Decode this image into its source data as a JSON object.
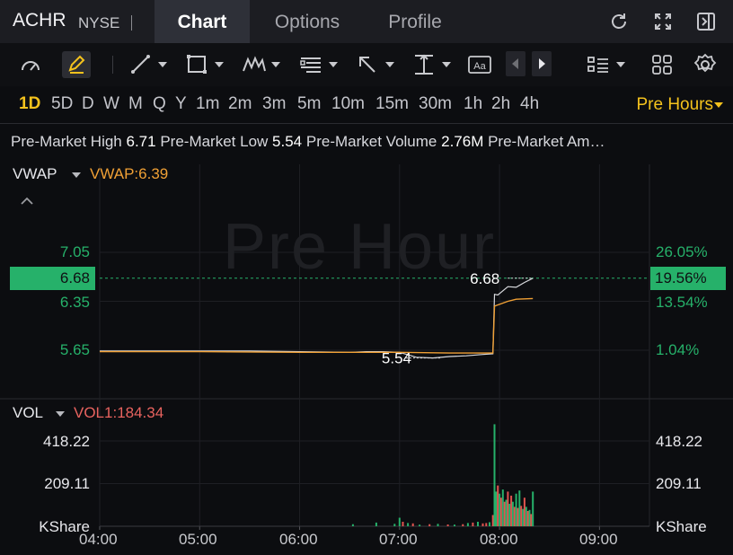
{
  "header": {
    "ticker": "ACHR",
    "exchange": "NYSE",
    "tabs": [
      {
        "label": "Chart",
        "active": true
      },
      {
        "label": "Options",
        "active": false
      },
      {
        "label": "Profile",
        "active": false
      }
    ],
    "icons": [
      "refresh-icon",
      "expand-icon",
      "collapse-panel-icon"
    ]
  },
  "toolbar": {
    "icons": [
      "gauge-icon",
      "pencil-icon",
      "line-tool-icon",
      "rectangle-tool-icon",
      "pattern-tool-icon",
      "fibonacci-tool-icon",
      "arrow-tool-icon",
      "measure-tool-icon",
      "text-tool-icon",
      "prev-icon",
      "next-icon",
      "layout-icon",
      "grid-icon",
      "settings-icon"
    ],
    "text_tool_label": "Aa"
  },
  "timeframes": [
    "1D",
    "5D",
    "D",
    "W",
    "M",
    "Q",
    "Y",
    "1m",
    "2m",
    "3m",
    "5m",
    "10m",
    "15m",
    "30m",
    "1h",
    "2h",
    "4h"
  ],
  "active_timeframe": "1D",
  "session": {
    "label": "Pre Hours"
  },
  "stats": {
    "high_label": "Pre-Market High",
    "high_value": "6.71",
    "low_label": "Pre-Market Low",
    "low_value": "5.54",
    "volume_label": "Pre-Market Volume",
    "volume_value": "2.76M",
    "amount_label": "Pre-Market Am…"
  },
  "price_panel": {
    "indicator": "VWAP",
    "indicator_value": "VWAP:6.39",
    "watermark": "Pre Hour",
    "left_ticks": [
      "7.05",
      "6.35",
      "5.65"
    ],
    "right_ticks": [
      "26.05%",
      "13.54%",
      "1.04%"
    ],
    "current_price": "6.68",
    "current_pct": "19.56%",
    "high_marker": "6.68",
    "low_marker": "5.54"
  },
  "volume_panel": {
    "indicator": "VOL",
    "indicator_value": "VOL1:184.34",
    "left_ticks": [
      "418.22",
      "209.11",
      "KShare"
    ],
    "right_ticks": [
      "418.22",
      "209.11",
      "KShare"
    ]
  },
  "time_axis": [
    "04:00",
    "05:00",
    "06:00",
    "07:00",
    "08:00",
    "09:00"
  ],
  "colors": {
    "up": "#26b16a",
    "down": "#e0534f",
    "vwap": "#f0a035",
    "price_line": "#d9dade",
    "accent": "#f4c21d",
    "volume_label": "#e8635f"
  },
  "chart_data": [
    {
      "type": "line",
      "title": "",
      "x_range": [
        "04:00",
        "09:00"
      ],
      "ylim": [
        5.43,
        7.35
      ],
      "yticks": [
        7.05,
        6.35,
        5.65
      ],
      "series": [
        {
          "name": "",
          "x": [
            "04:00",
            "04:30",
            "05:00",
            "05:30",
            "06:00",
            "06:30",
            "06:40",
            "06:50",
            "07:00",
            "07:10",
            "07:20",
            "07:30",
            "07:40",
            "07:50",
            "07:56",
            "07:57",
            "07:59",
            "08:05",
            "08:10",
            "08:15",
            "08:20"
          ],
          "values": [
            5.64,
            5.64,
            5.64,
            5.64,
            5.63,
            5.62,
            5.63,
            5.63,
            5.62,
            5.55,
            5.54,
            5.56,
            5.57,
            5.59,
            5.6,
            6.45,
            6.44,
            6.56,
            6.55,
            6.62,
            6.68
          ]
        },
        {
          "name": "VWAP",
          "x": [
            "04:00",
            "05:00",
            "06:00",
            "07:00",
            "07:30",
            "07:56",
            "07:57",
            "08:05",
            "08:10",
            "08:20"
          ],
          "values": [
            5.63,
            5.63,
            5.62,
            5.62,
            5.61,
            5.61,
            6.28,
            6.35,
            6.38,
            6.39
          ]
        }
      ]
    },
    {
      "type": "bar",
      "title": "",
      "ylabel": "KShare",
      "ylim": [
        0,
        520
      ],
      "yticks": [
        418.22,
        209.11
      ],
      "x": [
        "06:32",
        "06:46",
        "06:57",
        "07:00",
        "07:02",
        "07:05",
        "07:08",
        "07:12",
        "07:18",
        "07:23",
        "07:29",
        "07:33",
        "07:38",
        "07:41",
        "07:44",
        "07:47",
        "07:50",
        "07:52",
        "07:54",
        "07:56",
        "07:57",
        "07:58",
        "07:59",
        "08:00",
        "08:01",
        "08:02",
        "08:03",
        "08:04",
        "08:05",
        "08:06",
        "08:07",
        "08:08",
        "08:09",
        "08:10",
        "08:11",
        "08:12",
        "08:13",
        "08:14",
        "08:15",
        "08:16",
        "08:17",
        "08:18",
        "08:19",
        "08:20"
      ],
      "values": [
        10,
        18,
        12,
        42,
        22,
        16,
        14,
        8,
        10,
        12,
        9,
        8,
        10,
        16,
        18,
        22,
        14,
        16,
        20,
        55,
        500,
        170,
        200,
        160,
        140,
        180,
        120,
        130,
        170,
        110,
        150,
        120,
        95,
        160,
        90,
        175,
        100,
        85,
        140,
        95,
        75,
        80,
        60,
        170
      ],
      "direction": [
        "up",
        "up",
        "up",
        "up",
        "down",
        "up",
        "down",
        "up",
        "down",
        "up",
        "down",
        "up",
        "down",
        "up",
        "down",
        "up",
        "down",
        "down",
        "up",
        "down",
        "up",
        "up",
        "down",
        "up",
        "down",
        "up",
        "down",
        "up",
        "down",
        "up",
        "down",
        "up",
        "down",
        "up",
        "down",
        "up",
        "down",
        "up",
        "down",
        "up",
        "down",
        "up",
        "down",
        "up"
      ]
    }
  ]
}
